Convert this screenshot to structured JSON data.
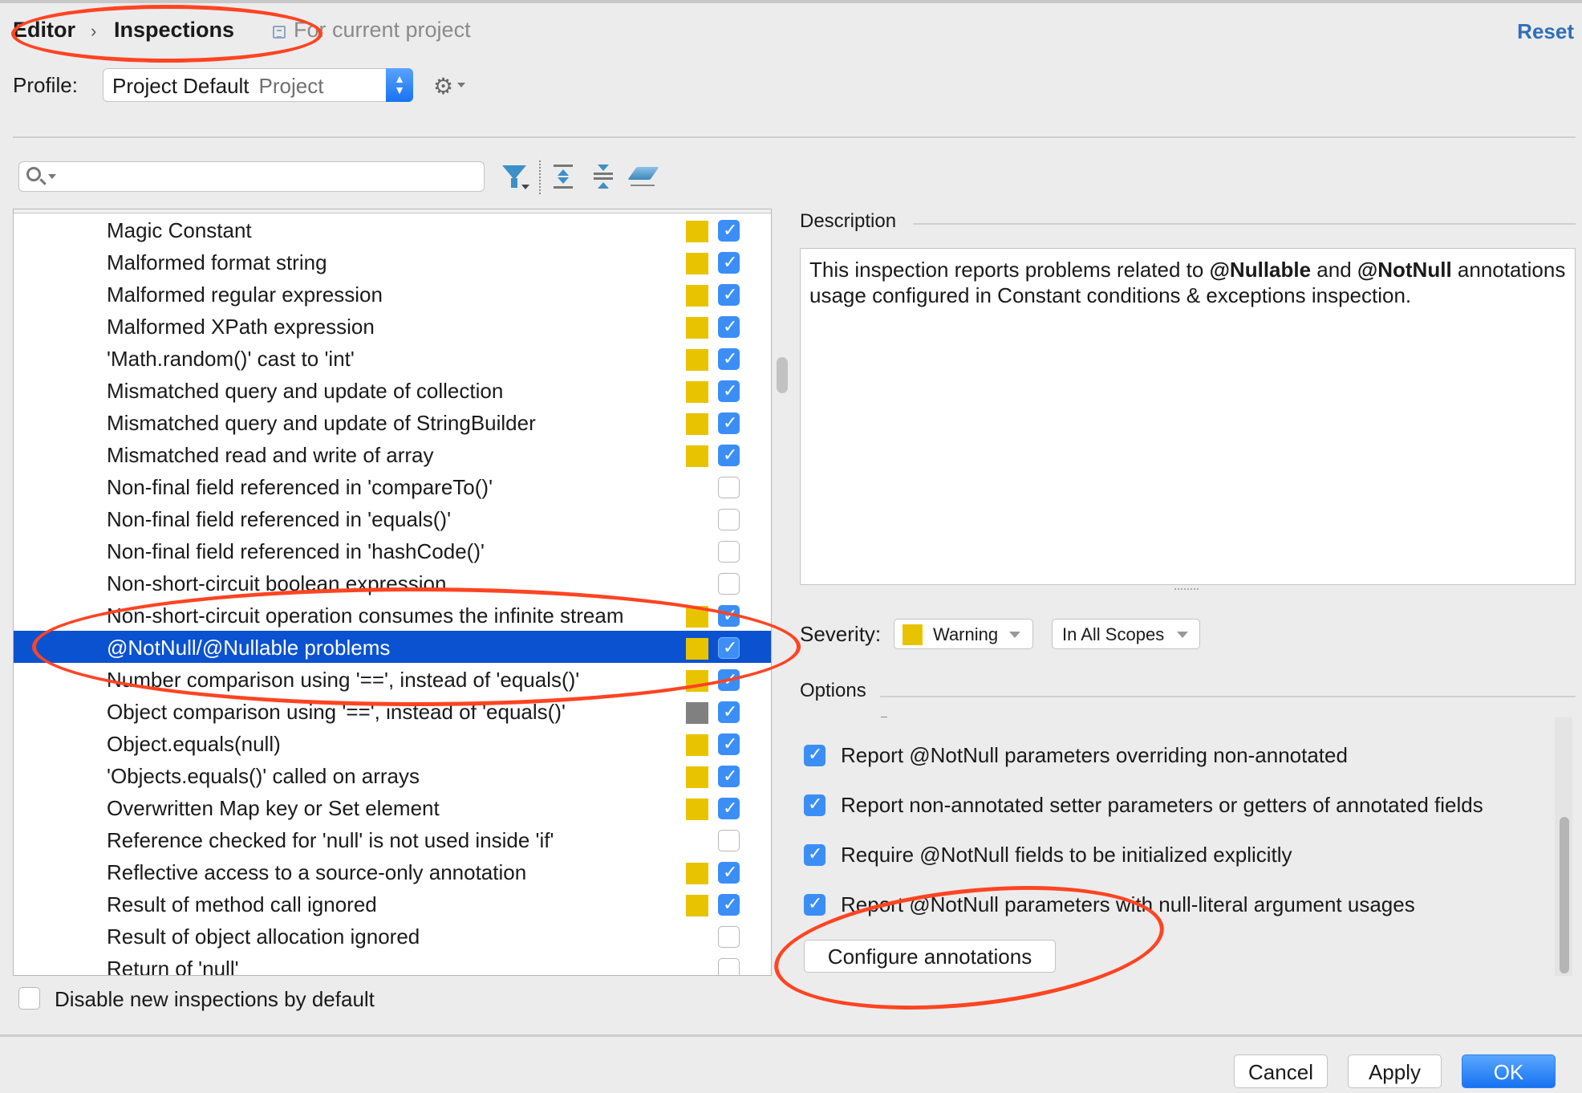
{
  "breadcrumb": {
    "parent": "Editor",
    "separator": "›",
    "current": "Inspections",
    "scope_note": "For current project"
  },
  "header": {
    "reset_label": "Reset"
  },
  "profile": {
    "label": "Profile:",
    "name": "Project Default",
    "type": "Project"
  },
  "search": {
    "value": "",
    "placeholder": ""
  },
  "toolbar": {
    "icons": [
      "filter-icon",
      "expand-all-icon",
      "collapse-all-icon",
      "reset-to-default-icon"
    ]
  },
  "colors": {
    "warning": "#e8c400",
    "weak_warning": "#808080",
    "selection": "#0b52d1",
    "accent": "#3b8ef5",
    "annotation": "#ff4422"
  },
  "inspections": [
    {
      "label": "Magic Constant",
      "severity": "warning",
      "enabled": true
    },
    {
      "label": "Malformed format string",
      "severity": "warning",
      "enabled": true
    },
    {
      "label": "Malformed regular expression",
      "severity": "warning",
      "enabled": true
    },
    {
      "label": "Malformed XPath expression",
      "severity": "warning",
      "enabled": true
    },
    {
      "label": "'Math.random()' cast to 'int'",
      "severity": "warning",
      "enabled": true
    },
    {
      "label": "Mismatched query and update of collection",
      "severity": "warning",
      "enabled": true
    },
    {
      "label": "Mismatched query and update of StringBuilder",
      "severity": "warning",
      "enabled": true
    },
    {
      "label": "Mismatched read and write of array",
      "severity": "warning",
      "enabled": true
    },
    {
      "label": "Non-final field referenced in 'compareTo()'",
      "severity": "none",
      "enabled": false
    },
    {
      "label": "Non-final field referenced in 'equals()'",
      "severity": "none",
      "enabled": false
    },
    {
      "label": "Non-final field referenced in 'hashCode()'",
      "severity": "none",
      "enabled": false
    },
    {
      "label": "Non-short-circuit boolean expression",
      "severity": "none",
      "enabled": false
    },
    {
      "label": "Non-short-circuit operation consumes the infinite stream",
      "severity": "warning",
      "enabled": true
    },
    {
      "label": "@NotNull/@Nullable problems",
      "severity": "warning",
      "enabled": true,
      "selected": true
    },
    {
      "label": "Number comparison using '==', instead of 'equals()'",
      "severity": "warning",
      "enabled": true
    },
    {
      "label": "Object comparison using '==', instead of 'equals()'",
      "severity": "weak_warning",
      "enabled": true
    },
    {
      "label": "Object.equals(null)",
      "severity": "warning",
      "enabled": true
    },
    {
      "label": "'Objects.equals()' called on arrays",
      "severity": "warning",
      "enabled": true
    },
    {
      "label": "Overwritten Map key or Set element",
      "severity": "warning",
      "enabled": true
    },
    {
      "label": "Reference checked for 'null' is not used inside 'if'",
      "severity": "none",
      "enabled": false
    },
    {
      "label": "Reflective access to a source-only annotation",
      "severity": "warning",
      "enabled": true
    },
    {
      "label": "Result of method call ignored",
      "severity": "warning",
      "enabled": true
    },
    {
      "label": "Result of object allocation ignored",
      "severity": "none",
      "enabled": false
    },
    {
      "label": "Return of 'null'",
      "severity": "none",
      "enabled": false
    }
  ],
  "description": {
    "label": "Description",
    "text_1": "This inspection reports problems related to ",
    "bold_1": "@Nullable",
    "text_2": " and ",
    "bold_2": "@NotNull",
    "text_3": " annotations usage configured in Constant conditions & exceptions inspection."
  },
  "severity": {
    "label": "Severity:",
    "value": "Warning",
    "scope": "In All Scopes"
  },
  "options": {
    "label": "Options",
    "items": [
      {
        "label": "Report @NotNull parameters overriding non-annotated",
        "checked": true
      },
      {
        "label": "Report non-annotated setter parameters or getters of annotated fields",
        "checked": true
      },
      {
        "label": "Require @NotNull fields to be initialized explicitly",
        "checked": true
      },
      {
        "label": "Report @NotNull parameters with null-literal argument usages",
        "checked": true
      }
    ],
    "configure_label": "Configure annotations"
  },
  "disable_new": {
    "label": "Disable new inspections by default",
    "checked": false
  },
  "footer": {
    "cancel": "Cancel",
    "apply": "Apply",
    "ok": "OK"
  }
}
